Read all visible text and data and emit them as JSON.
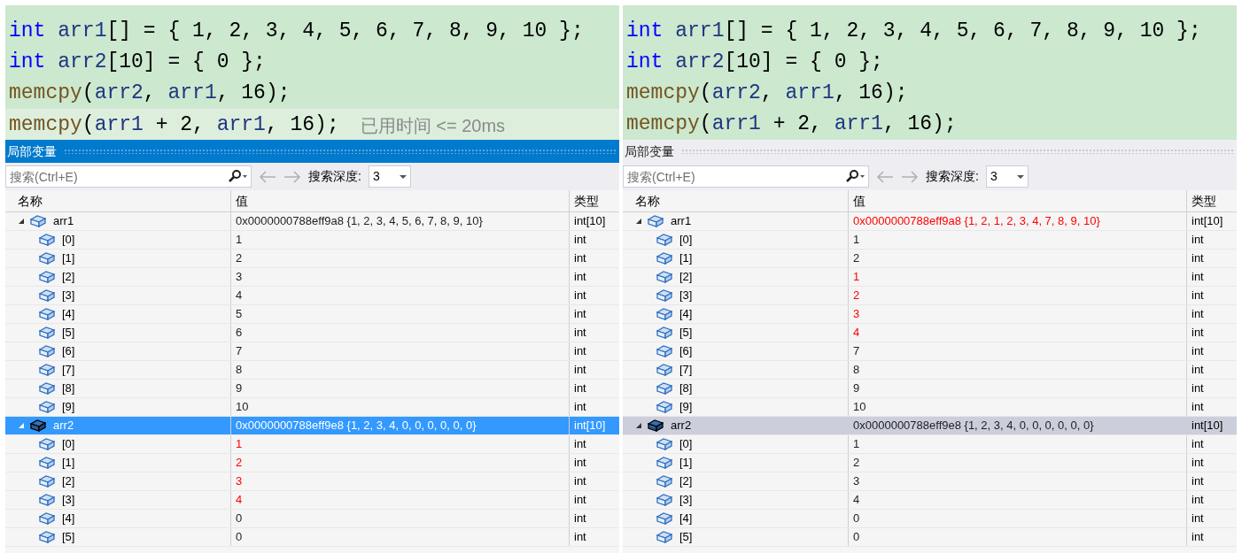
{
  "panels": [
    {
      "code": [
        {
          "current": false,
          "tokens": [
            {
              "kind": "keyword",
              "text": "int"
            },
            {
              "kind": "ident",
              "text": " arr1"
            },
            {
              "kind": "plain",
              "text": "[] = { 1, 2, 3, 4, 5, 6, 7, 8, 9, 10 };"
            }
          ]
        },
        {
          "current": false,
          "tokens": [
            {
              "kind": "keyword",
              "text": "int"
            },
            {
              "kind": "ident",
              "text": " arr2"
            },
            {
              "kind": "plain",
              "text": "[10] = { 0 };"
            }
          ]
        },
        {
          "current": false,
          "tokens": [
            {
              "kind": "function",
              "text": "memcpy"
            },
            {
              "kind": "plain",
              "text": "("
            },
            {
              "kind": "ident",
              "text": "arr2"
            },
            {
              "kind": "plain",
              "text": ", "
            },
            {
              "kind": "ident",
              "text": "arr1"
            },
            {
              "kind": "plain",
              "text": ", 16);"
            }
          ]
        },
        {
          "current": true,
          "tokens": [
            {
              "kind": "function",
              "text": "memcpy"
            },
            {
              "kind": "plain",
              "text": "("
            },
            {
              "kind": "ident",
              "text": "arr1"
            },
            {
              "kind": "plain",
              "text": " + 2, "
            },
            {
              "kind": "ident",
              "text": "arr1"
            },
            {
              "kind": "plain",
              "text": ", 16);"
            }
          ],
          "perf_tip": "已用时间 <= 20ms"
        }
      ],
      "locals": {
        "title": "局部变量",
        "active": true,
        "search_placeholder": "搜索(Ctrl+E)",
        "depth_label": "搜索深度:",
        "depth": "3",
        "columns": [
          "名称",
          "值",
          "类型"
        ],
        "rows": [
          {
            "name": "arr1",
            "value": "0x0000000788eff9a8 {1, 2, 3, 4, 5, 6, 7, 8, 9, 10}",
            "type": "int[10]",
            "changed": false,
            "selected": false,
            "expanded": true,
            "children": [
              {
                "name": "[0]",
                "value": "1",
                "type": "int",
                "changed": false,
                "selected": false
              },
              {
                "name": "[1]",
                "value": "2",
                "type": "int",
                "changed": false,
                "selected": false
              },
              {
                "name": "[2]",
                "value": "3",
                "type": "int",
                "changed": false,
                "selected": false
              },
              {
                "name": "[3]",
                "value": "4",
                "type": "int",
                "changed": false,
                "selected": false
              },
              {
                "name": "[4]",
                "value": "5",
                "type": "int",
                "changed": false,
                "selected": false
              },
              {
                "name": "[5]",
                "value": "6",
                "type": "int",
                "changed": false,
                "selected": false
              },
              {
                "name": "[6]",
                "value": "7",
                "type": "int",
                "changed": false,
                "selected": false
              },
              {
                "name": "[7]",
                "value": "8",
                "type": "int",
                "changed": false,
                "selected": false
              },
              {
                "name": "[8]",
                "value": "9",
                "type": "int",
                "changed": false,
                "selected": false
              },
              {
                "name": "[9]",
                "value": "10",
                "type": "int",
                "changed": false,
                "selected": false
              }
            ]
          },
          {
            "name": "arr2",
            "value": "0x0000000788eff9e8 {1, 2, 3, 4, 0, 0, 0, 0, 0, 0}",
            "type": "int[10]",
            "changed": false,
            "selected": true,
            "expanded": true,
            "children": [
              {
                "name": "[0]",
                "value": "1",
                "type": "int",
                "changed": true,
                "selected": false
              },
              {
                "name": "[1]",
                "value": "2",
                "type": "int",
                "changed": true,
                "selected": false
              },
              {
                "name": "[2]",
                "value": "3",
                "type": "int",
                "changed": true,
                "selected": false
              },
              {
                "name": "[3]",
                "value": "4",
                "type": "int",
                "changed": true,
                "selected": false
              },
              {
                "name": "[4]",
                "value": "0",
                "type": "int",
                "changed": false,
                "selected": false
              },
              {
                "name": "[5]",
                "value": "0",
                "type": "int",
                "changed": false,
                "selected": false
              }
            ]
          }
        ]
      }
    },
    {
      "code": [
        {
          "current": false,
          "tokens": [
            {
              "kind": "keyword",
              "text": "int"
            },
            {
              "kind": "ident",
              "text": " arr1"
            },
            {
              "kind": "plain",
              "text": "[] = { 1, 2, 3, 4, 5, 6, 7, 8, 9, 10 };"
            }
          ]
        },
        {
          "current": false,
          "tokens": [
            {
              "kind": "keyword",
              "text": "int"
            },
            {
              "kind": "ident",
              "text": " arr2"
            },
            {
              "kind": "plain",
              "text": "[10] = { 0 };"
            }
          ]
        },
        {
          "current": false,
          "tokens": [
            {
              "kind": "function",
              "text": "memcpy"
            },
            {
              "kind": "plain",
              "text": "("
            },
            {
              "kind": "ident",
              "text": "arr2"
            },
            {
              "kind": "plain",
              "text": ", "
            },
            {
              "kind": "ident",
              "text": "arr1"
            },
            {
              "kind": "plain",
              "text": ", 16);"
            }
          ]
        },
        {
          "current": false,
          "tokens": [
            {
              "kind": "function",
              "text": "memcpy"
            },
            {
              "kind": "plain",
              "text": "("
            },
            {
              "kind": "ident",
              "text": "arr1"
            },
            {
              "kind": "plain",
              "text": " + 2, "
            },
            {
              "kind": "ident",
              "text": "arr1"
            },
            {
              "kind": "plain",
              "text": ", 16);"
            }
          ]
        }
      ],
      "locals": {
        "title": "局部变量",
        "active": false,
        "search_placeholder": "搜索(Ctrl+E)",
        "depth_label": "搜索深度:",
        "depth": "3",
        "columns": [
          "名称",
          "值",
          "类型"
        ],
        "rows": [
          {
            "name": "arr1",
            "value": "0x0000000788eff9a8 {1, 2, 1, 2, 3, 4, 7, 8, 9, 10}",
            "type": "int[10]",
            "changed": true,
            "selected": false,
            "expanded": true,
            "children": [
              {
                "name": "[0]",
                "value": "1",
                "type": "int",
                "changed": false,
                "selected": false
              },
              {
                "name": "[1]",
                "value": "2",
                "type": "int",
                "changed": false,
                "selected": false
              },
              {
                "name": "[2]",
                "value": "1",
                "type": "int",
                "changed": true,
                "selected": false
              },
              {
                "name": "[3]",
                "value": "2",
                "type": "int",
                "changed": true,
                "selected": false
              },
              {
                "name": "[4]",
                "value": "3",
                "type": "int",
                "changed": true,
                "selected": false
              },
              {
                "name": "[5]",
                "value": "4",
                "type": "int",
                "changed": true,
                "selected": false
              },
              {
                "name": "[6]",
                "value": "7",
                "type": "int",
                "changed": false,
                "selected": false
              },
              {
                "name": "[7]",
                "value": "8",
                "type": "int",
                "changed": false,
                "selected": false
              },
              {
                "name": "[8]",
                "value": "9",
                "type": "int",
                "changed": false,
                "selected": false
              },
              {
                "name": "[9]",
                "value": "10",
                "type": "int",
                "changed": false,
                "selected": false
              }
            ]
          },
          {
            "name": "arr2",
            "value": "0x0000000788eff9e8 {1, 2, 3, 4, 0, 0, 0, 0, 0, 0}",
            "type": "int[10]",
            "changed": false,
            "selected": true,
            "expanded": true,
            "children": [
              {
                "name": "[0]",
                "value": "1",
                "type": "int",
                "changed": false,
                "selected": false
              },
              {
                "name": "[1]",
                "value": "2",
                "type": "int",
                "changed": false,
                "selected": false
              },
              {
                "name": "[2]",
                "value": "3",
                "type": "int",
                "changed": false,
                "selected": false
              },
              {
                "name": "[3]",
                "value": "4",
                "type": "int",
                "changed": false,
                "selected": false
              },
              {
                "name": "[4]",
                "value": "0",
                "type": "int",
                "changed": false,
                "selected": false
              },
              {
                "name": "[5]",
                "value": "0",
                "type": "int",
                "changed": false,
                "selected": false
              }
            ]
          }
        ]
      }
    }
  ]
}
